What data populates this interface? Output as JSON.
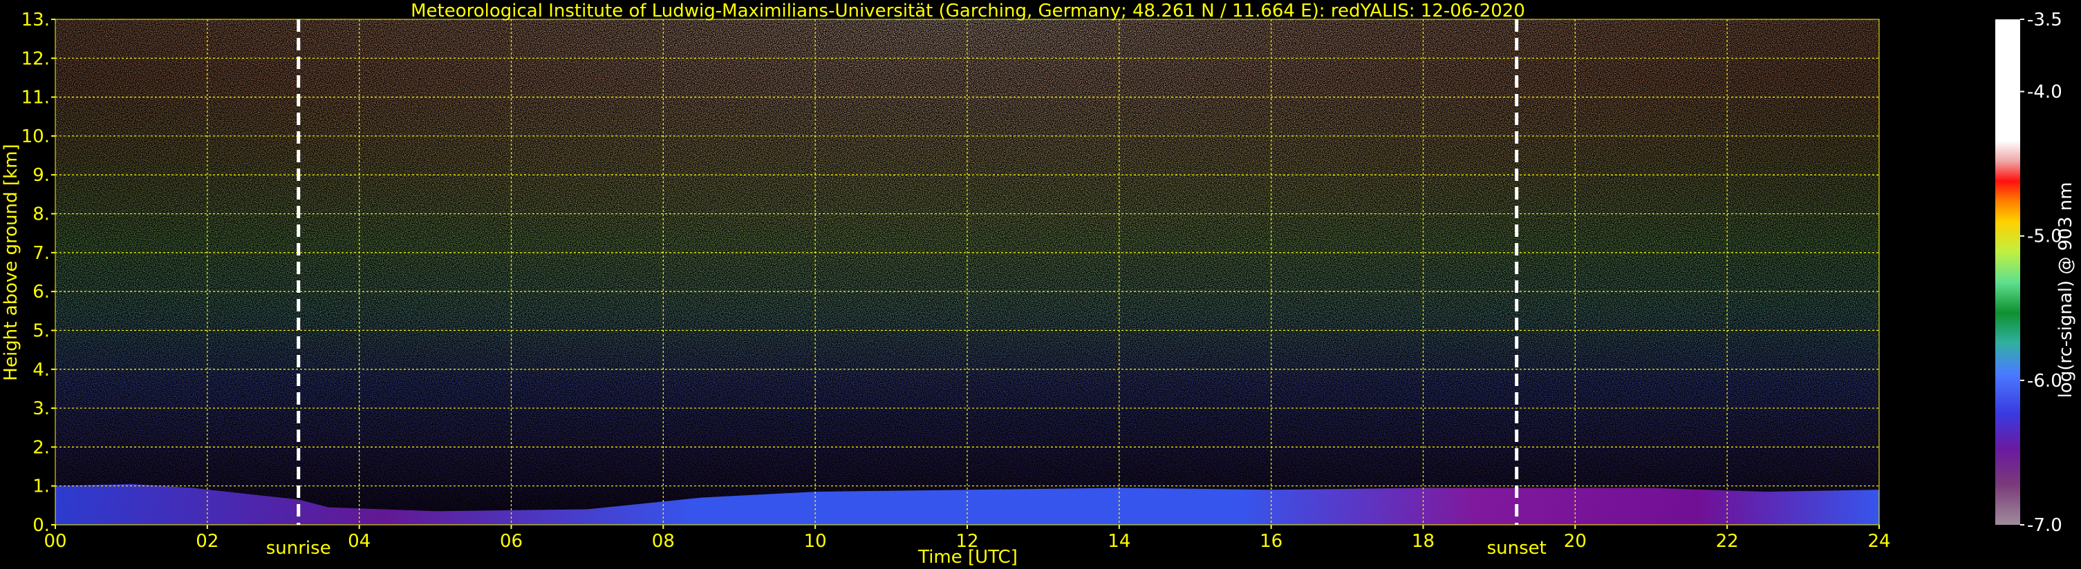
{
  "chart_data": {
    "type": "heatmap",
    "title": "Meteorological Institute of Ludwig-Maximilians-Universität (Garching, Germany; 48.261 N / 11.664 E):    redYALIS: 12-06-2020",
    "xlabel": "Time [UTC]",
    "ylabel": "Height above ground [km]",
    "xlim": [
      0,
      24
    ],
    "ylim": [
      0,
      13
    ],
    "x_ticks": [
      "00",
      "02",
      "04",
      "06",
      "08",
      "10",
      "12",
      "14",
      "16",
      "18",
      "20",
      "22",
      "24"
    ],
    "y_ticks": [
      "0.",
      "1.",
      "2.",
      "3.",
      "4.",
      "5.",
      "6.",
      "7.",
      "8.",
      "9.",
      "10.",
      "11.",
      "12.",
      "13."
    ],
    "grid": true,
    "colorbar": {
      "label": "log(rc-signal) @ 903 nm",
      "range": [
        -7.0,
        -3.5
      ],
      "ticks": [
        "-3.5",
        "-4.0",
        "-5.0",
        "-6.0",
        "-7.0"
      ],
      "tick_values": [
        -3.5,
        -4.0,
        -5.0,
        -6.0,
        -7.0
      ]
    },
    "annotations": [
      {
        "label": "sunrise",
        "x": 3.2
      },
      {
        "label": "sunset",
        "x": 19.23
      }
    ],
    "colors": {
      "text": "#ffff00",
      "grid": "#ffff00",
      "background": "#000000",
      "marker_lines": "#ffffff"
    }
  }
}
